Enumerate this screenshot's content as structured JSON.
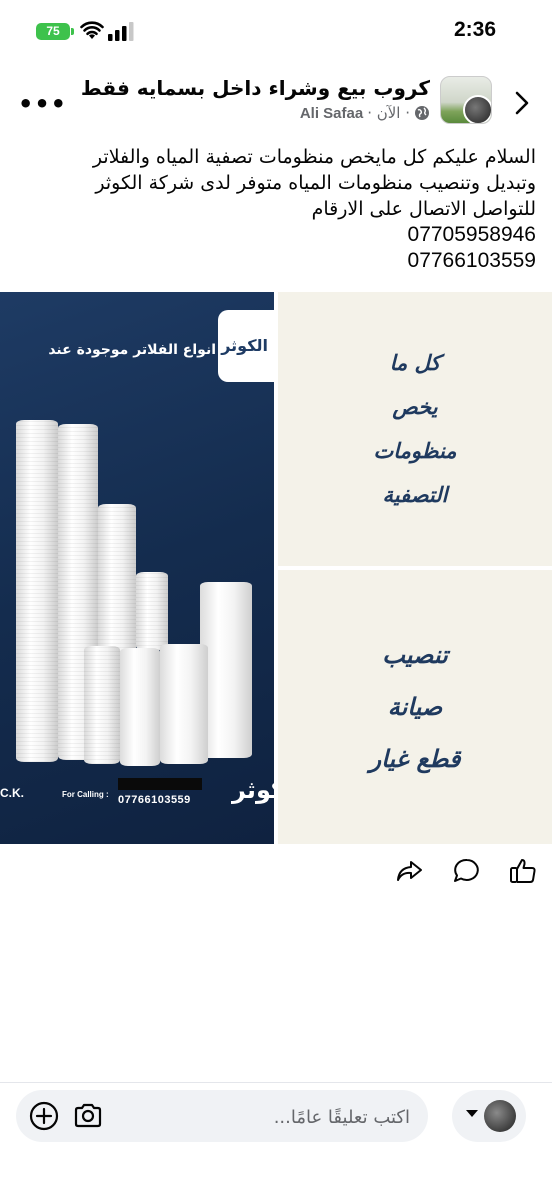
{
  "status_bar": {
    "time": "2:36",
    "battery": "75"
  },
  "header": {
    "group_name": "كروب بيع وشراء داخل بسمايه فقط",
    "author": "Ali Safaa",
    "timestamp": "· الآن ·"
  },
  "post": {
    "lines": [
      "السلام عليكم كل مايخص منظومات تصفية المياه والفلاتر",
      "وتبديل وتنصيب منظومات المياه متوفر لدى شركة الكوثر",
      "للتواصل الاتصال على الارقام"
    ],
    "phones": [
      "07705958946",
      "07766103559"
    ]
  },
  "image_main": {
    "banner": "انواع الفلاتر موجودة عند",
    "logo": "الكوثر",
    "for_calling": "For Calling :",
    "phone": "07766103559",
    "initials": "C.K.",
    "corner_brand": "لكوثر"
  },
  "tile1": {
    "lines": [
      "كل ما",
      "يخص",
      "منظومات",
      "التصفية"
    ]
  },
  "tile2": {
    "lines": [
      "تنصيب",
      "صيانة",
      "قطع غيار"
    ]
  },
  "composer": {
    "placeholder": "اكتب تعليقًا عامًا..."
  },
  "colors": {
    "tile_bg": "#f4f2e9",
    "tile_text": "#1f3a5f",
    "image_bg": "#1e3b64",
    "battery": "#3ec24c"
  }
}
